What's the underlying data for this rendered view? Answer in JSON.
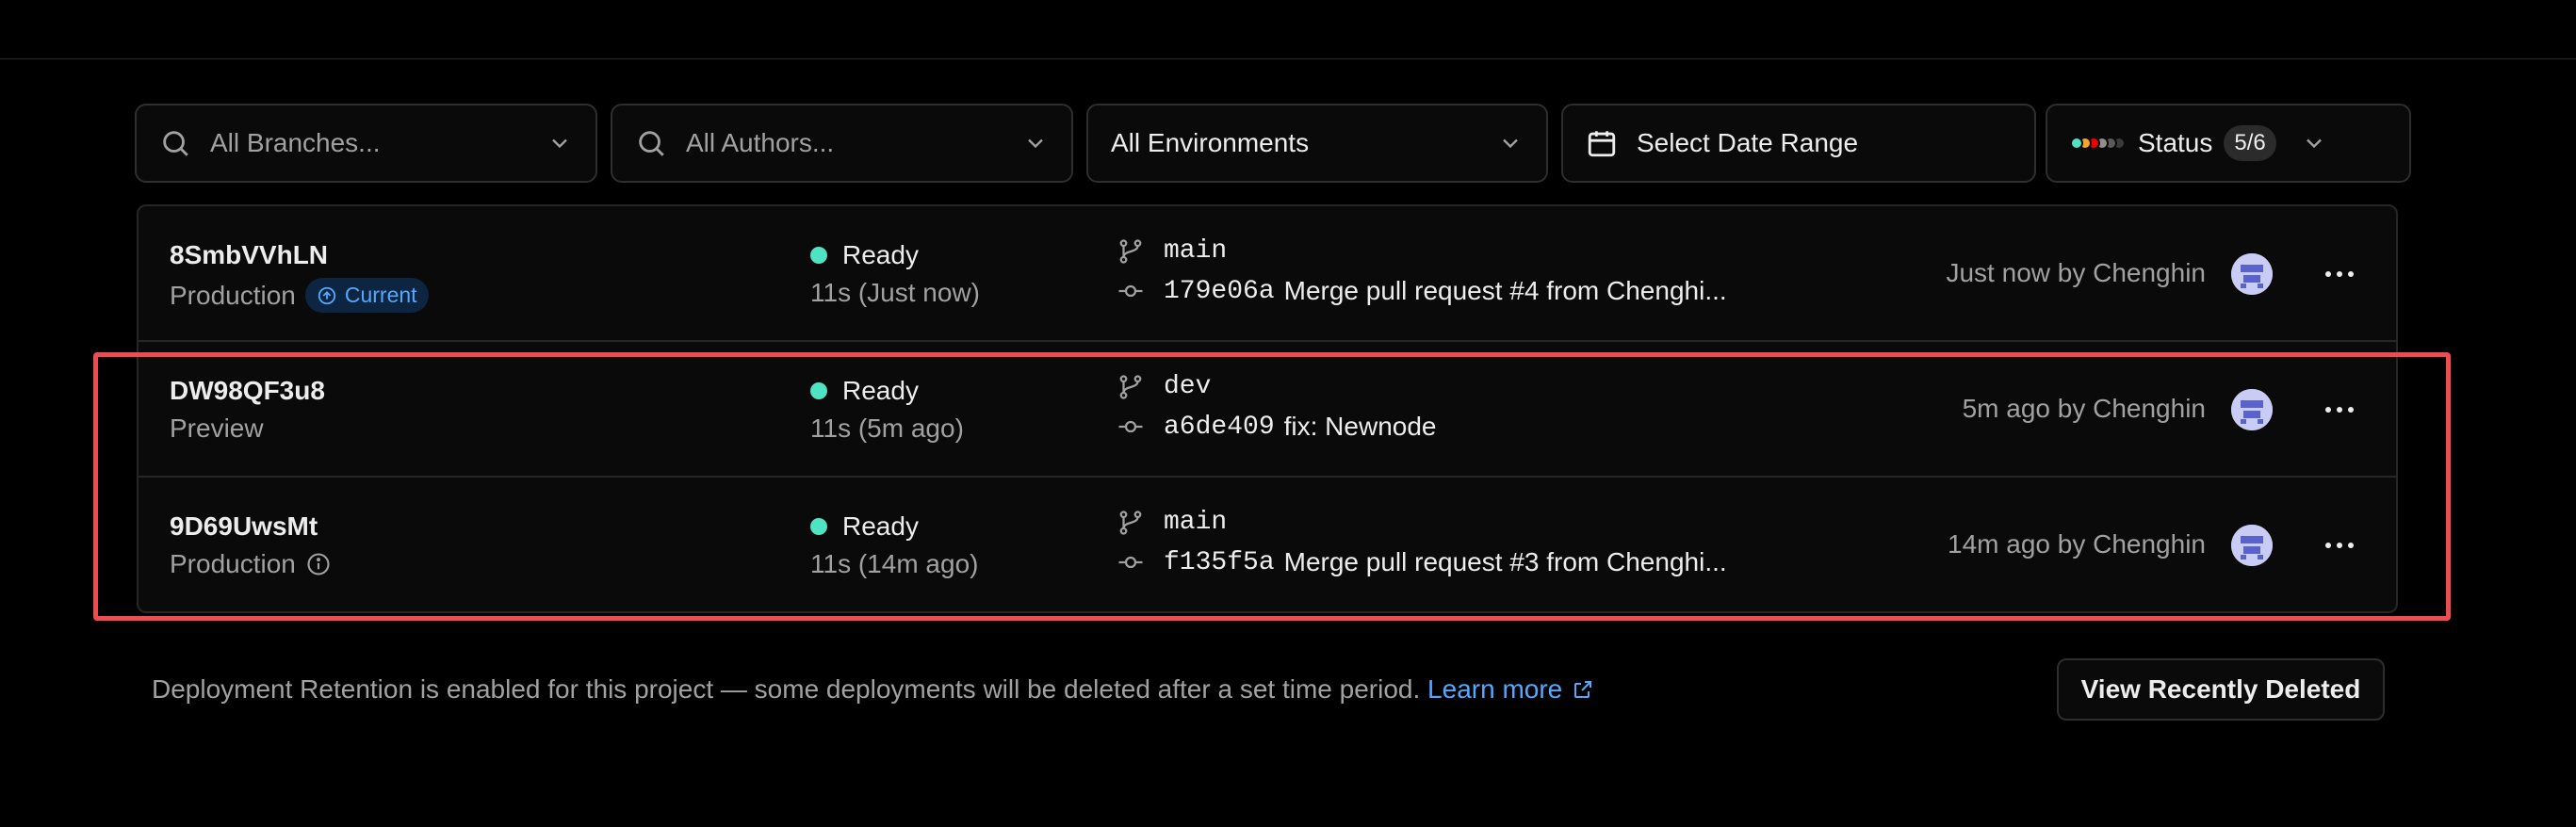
{
  "filters": {
    "branches_placeholder": "All Branches...",
    "authors_placeholder": "All Authors...",
    "environments_value": "All Environments",
    "date_range_label": "Select Date Range",
    "status_label": "Status",
    "status_count": "5/6",
    "status_colors": [
      "#50e3c2",
      "#f5a623",
      "#ee0000",
      "#8f8f8f",
      "#5a5a5a",
      "#3a3a3a"
    ]
  },
  "deployments": [
    {
      "id": "8SmbVVhLN",
      "environment": "Production",
      "current_label": "Current",
      "status": "Ready",
      "duration": "11s (Just now)",
      "branch": "main",
      "commit_hash": "179e06a",
      "commit_message": "Merge pull request #4 from Chenghi...",
      "byline": "Just now by Chenghin"
    },
    {
      "id": "DW98QF3u8",
      "environment": "Preview",
      "status": "Ready",
      "duration": "11s (5m ago)",
      "branch": "dev",
      "commit_hash": "a6de409",
      "commit_message": "fix: Newnode",
      "byline": "5m ago by Chenghin"
    },
    {
      "id": "9D69UwsMt",
      "environment": "Production",
      "status": "Ready",
      "duration": "11s (14m ago)",
      "branch": "main",
      "commit_hash": "f135f5a",
      "commit_message": "Merge pull request #3 from Chenghi...",
      "byline": "14m ago by Chenghin"
    }
  ],
  "footer": {
    "notice": "Deployment Retention is enabled for this project — some deployments will be deleted after a set time period.",
    "learn_more": "Learn more",
    "view_deleted": "View Recently Deleted"
  },
  "colors": {
    "ready": "#50e3c2",
    "link": "#52a8ff",
    "highlight": "#ef4b50"
  }
}
